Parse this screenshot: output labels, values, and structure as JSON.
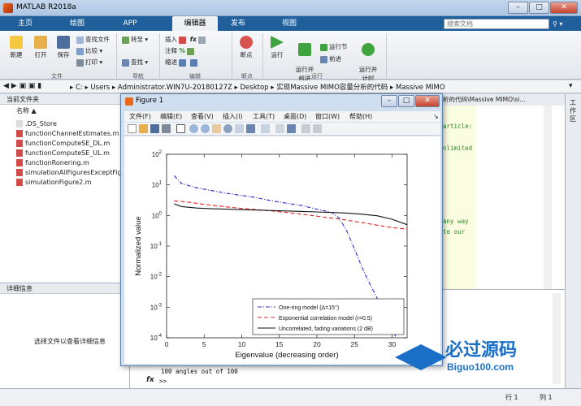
{
  "window": {
    "title": "MATLAB R2018a"
  },
  "tabs": [
    "主页",
    "绘图",
    "APP",
    "编辑器",
    "发布",
    "视图"
  ],
  "active_tab": "编辑器",
  "search": {
    "placeholder": "搜索文档"
  },
  "ribbon": {
    "file": {
      "new": "新建",
      "open": "打开",
      "save": "保存",
      "find_file": "查找文件",
      "compare": "比较",
      "print": "打印",
      "group": "文件"
    },
    "nav": {
      "insert": "插入",
      "comment": "注释",
      "indent": "缩进",
      "goto": "转至",
      "find": "查找",
      "group": "导航"
    },
    "edit": {
      "group": "编辑"
    },
    "breakpoint": {
      "label": "断点",
      "group": "断点"
    },
    "run": {
      "run": "运行",
      "run_advance": "运行并\n前进",
      "run_section": "运行节",
      "advance": "前进",
      "run_time": "运行并\n计时",
      "group": "运行"
    }
  },
  "address": {
    "path": "▸ C: ▸ Users ▸ Administrator.WIN7U-20180127Z ▸ Desktop ▸ 实现Massive MIMO容量分析的代码 ▸ Massive MIMO"
  },
  "current_folder": {
    "title": "当前文件夹",
    "column": "名称",
    "files": [
      ".DS_Store",
      "functionChannelEstimates.m",
      "functionComputeSE_DL.m",
      "functionComputeSE_UL.m",
      "functionRonering.m",
      "simulationAllFiguresExceptFig",
      "simulationFigure2.m"
    ]
  },
  "details": {
    "title": "详细信息",
    "hint": "选择文件以查看详细信息"
  },
  "editor": {
    "path_tail": "析的代码\\Massive MIMO\\si...",
    "lines": [
      "article:",
      "",
      "nlimited",
      "",
      "",
      "",
      "",
      "any way",
      "te our"
    ]
  },
  "command": {
    "output": "100 angles out of 100",
    "prompt": ">>"
  },
  "status": {
    "row_label": "行 1",
    "col_label": "列 1"
  },
  "right_strip": "工作区",
  "figure": {
    "title": "Figure 1",
    "menus": [
      "文件(F)",
      "编辑(E)",
      "查看(V)",
      "插入(I)",
      "工具(T)",
      "桌面(D)",
      "窗口(W)",
      "帮助(H)"
    ]
  },
  "chart_data": {
    "type": "line",
    "xlabel": "Eigenvalue (decreasing order)",
    "ylabel": "Normalized value",
    "xlim": [
      0,
      32
    ],
    "ylim": [
      0.0001,
      100
    ],
    "yscale": "log",
    "xticks": [
      "0",
      "5",
      "10",
      "15",
      "20",
      "25",
      "30"
    ],
    "yticks": [
      "10^-4",
      "10^-3",
      "10^-2",
      "10^-1",
      "10^0",
      "10^1",
      "10^2"
    ],
    "legend_position": "bottom-right",
    "series": [
      {
        "name": "One-ring model (Δ=15°)",
        "color": "#2a2ad6",
        "style": "dashdot",
        "x": [
          1,
          2,
          4,
          6,
          8,
          10,
          12,
          14,
          16,
          18,
          20,
          22,
          23,
          24,
          25,
          26,
          27,
          28,
          29,
          30,
          30.5
        ],
        "y": [
          20,
          11,
          8,
          6.5,
          5.3,
          4.5,
          3.8,
          3.0,
          2.5,
          2.1,
          1.6,
          1.25,
          0.8,
          0.3,
          0.08,
          0.02,
          0.006,
          0.002,
          0.0007,
          0.00025,
          0.0001
        ]
      },
      {
        "name": "Exponential correlation model (r=0.5)",
        "color": "#e02020",
        "style": "dashed",
        "x": [
          1,
          3,
          5,
          8,
          10,
          12,
          14,
          16,
          18,
          20,
          22,
          24,
          26,
          28,
          30,
          32
        ],
        "y": [
          3.0,
          2.7,
          2.3,
          1.9,
          1.7,
          1.55,
          1.4,
          1.25,
          1.1,
          0.95,
          0.82,
          0.7,
          0.58,
          0.48,
          0.4,
          0.36
        ]
      },
      {
        "name": "Uncorrelated, fading variations (2 dB)",
        "color": "#111111",
        "style": "solid",
        "x": [
          1,
          2,
          4,
          6,
          8,
          10,
          12,
          14,
          16,
          18,
          20,
          22,
          24,
          26,
          28,
          30,
          32
        ],
        "y": [
          2.4,
          1.95,
          1.75,
          1.65,
          1.6,
          1.55,
          1.5,
          1.45,
          1.4,
          1.35,
          1.3,
          1.25,
          1.2,
          1.1,
          0.98,
          0.75,
          0.5
        ]
      }
    ]
  },
  "watermark": {
    "text": "必过源码",
    "sub": "Biguo100.com"
  }
}
